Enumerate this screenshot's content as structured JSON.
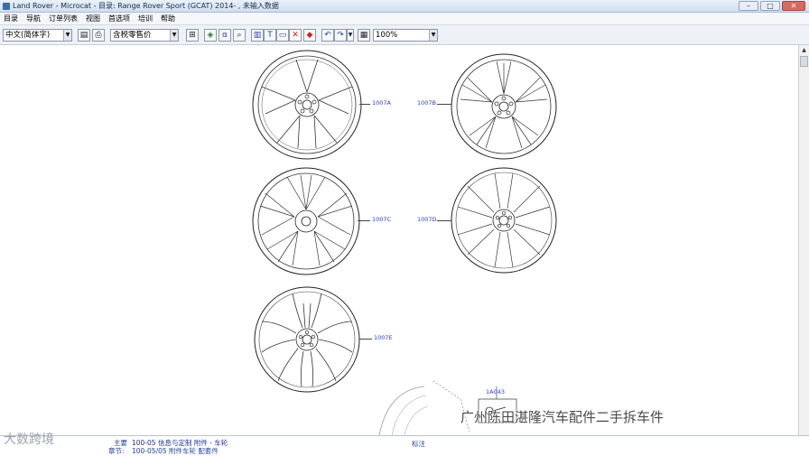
{
  "window": {
    "title": "Land Rover - Microcat - 目录: Range Rover Sport (GCAT) 2014- , 未输入数据",
    "controls": {
      "minimize": "–",
      "maximize": "□",
      "close": "✕"
    }
  },
  "menu": [
    "目录",
    "导航",
    "订单列表",
    "视图",
    "首选项",
    "培训",
    "帮助"
  ],
  "toolbar": {
    "language": "中文(简体字)",
    "price_mode": "含税零售价",
    "zoom": "100%",
    "alpha_label": "α"
  },
  "diagram": {
    "callouts": [
      "1007A",
      "1007B",
      "1007C",
      "1007D",
      "1007E",
      "1A043"
    ]
  },
  "status": {
    "row1_key": "主要",
    "row1_value": "100-05  信息与定制  附件 - 车轮",
    "row2_key": "章节:",
    "row2_value": "100-05/05  附件车轮  配套件",
    "note_label": "标注"
  },
  "watermarks": {
    "left": "大数跨境",
    "right": "广州陈田湛隆汽车配件二手拆车件"
  },
  "colors": {
    "callout_text": "#2b3bd6",
    "status_text": "#1f3f9f",
    "title_gradient_top": "#e9f1fb"
  }
}
